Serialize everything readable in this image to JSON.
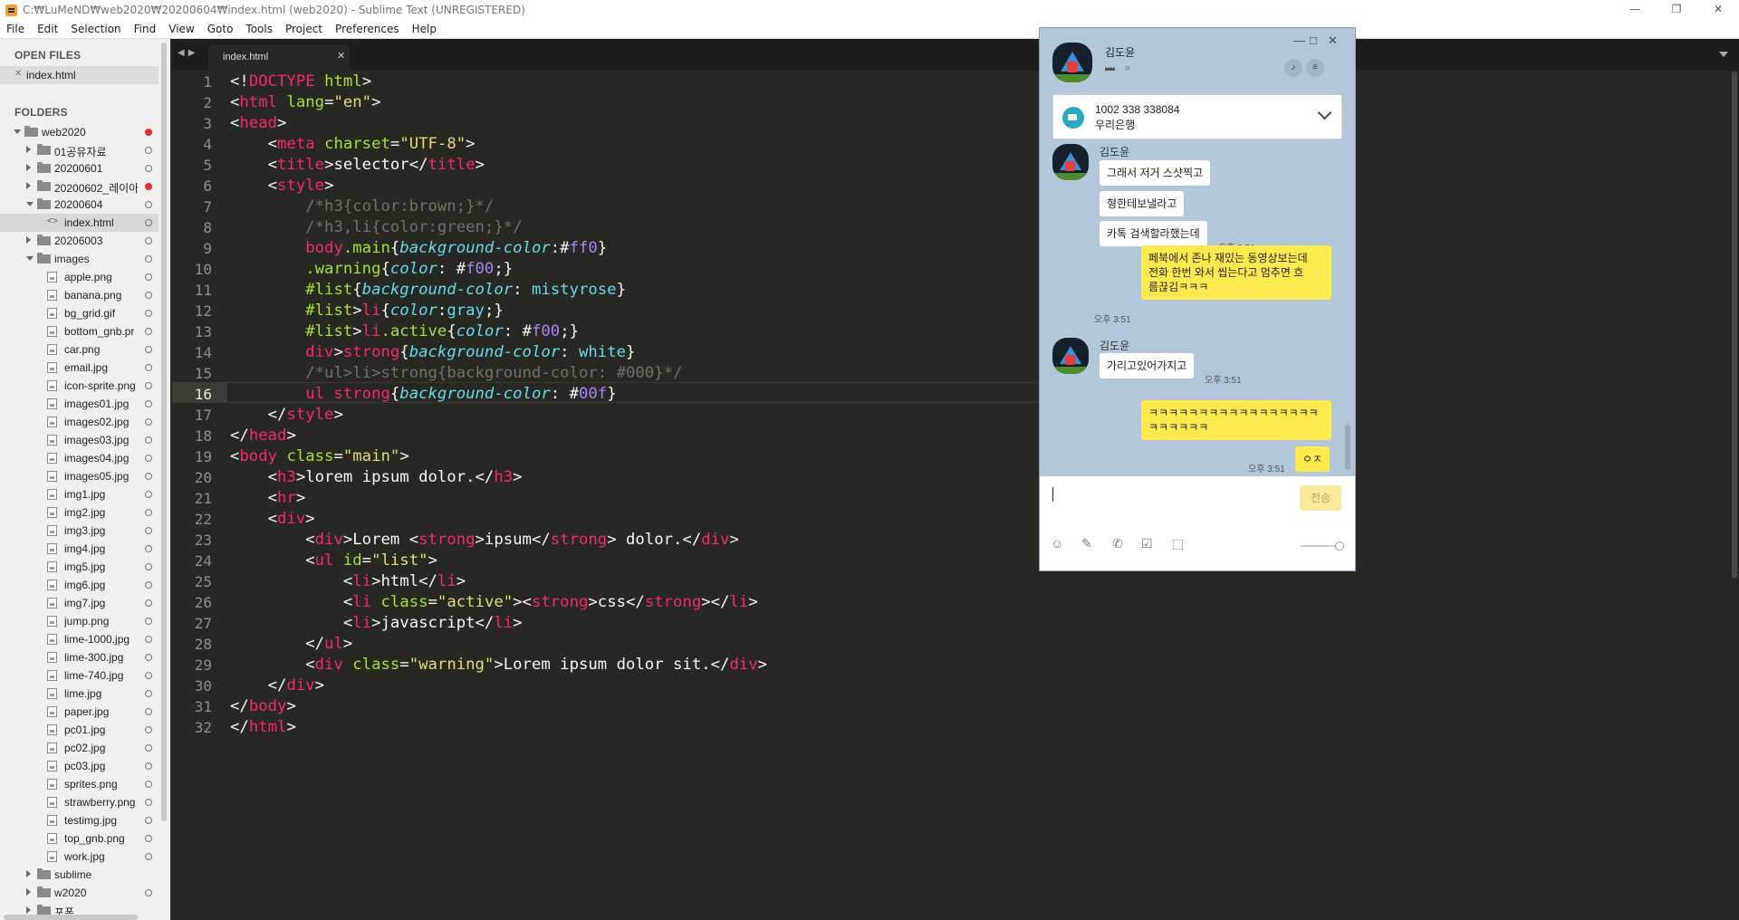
{
  "window": {
    "title": "C:₩LuMeND₩web2020₩20200604₩index.html (web2020) - Sublime Text (UNREGISTERED)",
    "controls": [
      "—",
      "❐",
      "✕"
    ]
  },
  "menu": [
    "File",
    "Edit",
    "Selection",
    "Find",
    "View",
    "Goto",
    "Tools",
    "Project",
    "Preferences",
    "Help"
  ],
  "sidebar": {
    "open_files_header": "OPEN FILES",
    "open_file": "index.html",
    "folders_header": "FOLDERS",
    "tree": [
      {
        "label": "web2020",
        "kind": "folder",
        "depth": 0,
        "arrow": "open",
        "status": "red"
      },
      {
        "label": "01공유자료",
        "kind": "folder",
        "depth": 1,
        "arrow": "closed",
        "status": "circle"
      },
      {
        "label": "20200601",
        "kind": "folder",
        "depth": 1,
        "arrow": "closed",
        "status": "circle"
      },
      {
        "label": "20200602_레이아",
        "kind": "folder",
        "depth": 1,
        "arrow": "closed",
        "status": "red"
      },
      {
        "label": "20200604",
        "kind": "folder",
        "depth": 1,
        "arrow": "open",
        "status": "circle"
      },
      {
        "label": "index.html",
        "kind": "code",
        "depth": 2,
        "arrow": "none",
        "status": "circle",
        "selected": true
      },
      {
        "label": "20206003",
        "kind": "folder",
        "depth": 1,
        "arrow": "closed",
        "status": "circle"
      },
      {
        "label": "images",
        "kind": "folder",
        "depth": 1,
        "arrow": "open",
        "status": "circle"
      },
      {
        "label": "apple.png",
        "kind": "file",
        "depth": 2,
        "arrow": "none",
        "status": "circle"
      },
      {
        "label": "banana.png",
        "kind": "file",
        "depth": 2,
        "arrow": "none",
        "status": "circle"
      },
      {
        "label": "bg_grid.gif",
        "kind": "file",
        "depth": 2,
        "arrow": "none",
        "status": "circle"
      },
      {
        "label": "bottom_gnb.pr",
        "kind": "file",
        "depth": 2,
        "arrow": "none",
        "status": "circle"
      },
      {
        "label": "car.png",
        "kind": "file",
        "depth": 2,
        "arrow": "none",
        "status": "circle"
      },
      {
        "label": "email.jpg",
        "kind": "file",
        "depth": 2,
        "arrow": "none",
        "status": "circle"
      },
      {
        "label": "icon-sprite.png",
        "kind": "file",
        "depth": 2,
        "arrow": "none",
        "status": "circle"
      },
      {
        "label": "images01.jpg",
        "kind": "file",
        "depth": 2,
        "arrow": "none",
        "status": "circle"
      },
      {
        "label": "images02.jpg",
        "kind": "file",
        "depth": 2,
        "arrow": "none",
        "status": "circle"
      },
      {
        "label": "images03.jpg",
        "kind": "file",
        "depth": 2,
        "arrow": "none",
        "status": "circle"
      },
      {
        "label": "images04.jpg",
        "kind": "file",
        "depth": 2,
        "arrow": "none",
        "status": "circle"
      },
      {
        "label": "images05.jpg",
        "kind": "file",
        "depth": 2,
        "arrow": "none",
        "status": "circle"
      },
      {
        "label": "img1.jpg",
        "kind": "file",
        "depth": 2,
        "arrow": "none",
        "status": "circle"
      },
      {
        "label": "img2.jpg",
        "kind": "file",
        "depth": 2,
        "arrow": "none",
        "status": "circle"
      },
      {
        "label": "img3.jpg",
        "kind": "file",
        "depth": 2,
        "arrow": "none",
        "status": "circle"
      },
      {
        "label": "img4.jpg",
        "kind": "file",
        "depth": 2,
        "arrow": "none",
        "status": "circle"
      },
      {
        "label": "img5.jpg",
        "kind": "file",
        "depth": 2,
        "arrow": "none",
        "status": "circle"
      },
      {
        "label": "img6.jpg",
        "kind": "file",
        "depth": 2,
        "arrow": "none",
        "status": "circle"
      },
      {
        "label": "img7.jpg",
        "kind": "file",
        "depth": 2,
        "arrow": "none",
        "status": "circle"
      },
      {
        "label": "jump.png",
        "kind": "file",
        "depth": 2,
        "arrow": "none",
        "status": "circle"
      },
      {
        "label": "lime-1000.jpg",
        "kind": "file",
        "depth": 2,
        "arrow": "none",
        "status": "circle"
      },
      {
        "label": "lime-300.jpg",
        "kind": "file",
        "depth": 2,
        "arrow": "none",
        "status": "circle"
      },
      {
        "label": "lime-740.jpg",
        "kind": "file",
        "depth": 2,
        "arrow": "none",
        "status": "circle"
      },
      {
        "label": "lime.jpg",
        "kind": "file",
        "depth": 2,
        "arrow": "none",
        "status": "circle"
      },
      {
        "label": "paper.jpg",
        "kind": "file",
        "depth": 2,
        "arrow": "none",
        "status": "circle"
      },
      {
        "label": "pc01.jpg",
        "kind": "file",
        "depth": 2,
        "arrow": "none",
        "status": "circle"
      },
      {
        "label": "pc02.jpg",
        "kind": "file",
        "depth": 2,
        "arrow": "none",
        "status": "circle"
      },
      {
        "label": "pc03.jpg",
        "kind": "file",
        "depth": 2,
        "arrow": "none",
        "status": "circle"
      },
      {
        "label": "sprites.png",
        "kind": "file",
        "depth": 2,
        "arrow": "none",
        "status": "circle"
      },
      {
        "label": "strawberry.png",
        "kind": "file",
        "depth": 2,
        "arrow": "none",
        "status": "circle"
      },
      {
        "label": "testimg.jpg",
        "kind": "file",
        "depth": 2,
        "arrow": "none",
        "status": "circle"
      },
      {
        "label": "top_gnb.png",
        "kind": "file",
        "depth": 2,
        "arrow": "none",
        "status": "circle"
      },
      {
        "label": "work.jpg",
        "kind": "file",
        "depth": 2,
        "arrow": "none",
        "status": "circle"
      },
      {
        "label": "sublime",
        "kind": "folder",
        "depth": 1,
        "arrow": "closed",
        "status": "none"
      },
      {
        "label": "w2020",
        "kind": "folder",
        "depth": 1,
        "arrow": "closed",
        "status": "circle"
      },
      {
        "label": "포폰",
        "kind": "folder",
        "depth": 1,
        "arrow": "closed",
        "status": "none"
      }
    ]
  },
  "editor": {
    "tab_label": "index.html",
    "tab_close": "✕",
    "current_line": 16,
    "lines": [
      [
        [
          "w",
          "<!"
        ],
        [
          "t",
          "DOCTYPE"
        ],
        [
          "w",
          " "
        ],
        [
          "a",
          "html"
        ],
        [
          "w",
          ">"
        ]
      ],
      [
        [
          "w",
          "<"
        ],
        [
          "t",
          "html"
        ],
        [
          "w",
          " "
        ],
        [
          "a",
          "lang"
        ],
        [
          "w",
          "="
        ],
        [
          "s",
          "\"en\""
        ],
        [
          "w",
          ">"
        ]
      ],
      [
        [
          "w",
          "<"
        ],
        [
          "t",
          "head"
        ],
        [
          "w",
          ">"
        ]
      ],
      [
        [
          "w",
          "    <"
        ],
        [
          "t",
          "meta"
        ],
        [
          "w",
          " "
        ],
        [
          "a",
          "charset"
        ],
        [
          "w",
          "="
        ],
        [
          "s",
          "\"UTF-8\""
        ],
        [
          "w",
          ">"
        ]
      ],
      [
        [
          "w",
          "    <"
        ],
        [
          "t",
          "title"
        ],
        [
          "w",
          ">selector</"
        ],
        [
          "t",
          "title"
        ],
        [
          "w",
          ">"
        ]
      ],
      [
        [
          "w",
          "    <"
        ],
        [
          "t",
          "style"
        ],
        [
          "w",
          ">"
        ]
      ],
      [
        [
          "c",
          "        /*h3{color:brown;}*/"
        ]
      ],
      [
        [
          "c",
          "        /*h3,li{color:green;}*/"
        ]
      ],
      [
        [
          "w",
          "        "
        ],
        [
          "t",
          "body"
        ],
        [
          "a",
          ".main"
        ],
        [
          "w",
          "{"
        ],
        [
          "p",
          "background-color"
        ],
        [
          "w",
          ":"
        ],
        [
          "w",
          "#"
        ],
        [
          "n",
          "ff0"
        ],
        [
          "w",
          "}"
        ]
      ],
      [
        [
          "w",
          "        "
        ],
        [
          "a",
          ".warning"
        ],
        [
          "w",
          "{"
        ],
        [
          "p",
          "color"
        ],
        [
          "w",
          ": #"
        ],
        [
          "n",
          "f00"
        ],
        [
          "w",
          ";}"
        ]
      ],
      [
        [
          "w",
          "        "
        ],
        [
          "a",
          "#list"
        ],
        [
          "w",
          "{"
        ],
        [
          "p",
          "background-color"
        ],
        [
          "w",
          ": "
        ],
        [
          "v",
          "mistyrose"
        ],
        [
          "w",
          "}"
        ]
      ],
      [
        [
          "w",
          "        "
        ],
        [
          "a",
          "#list"
        ],
        [
          "w",
          ">"
        ],
        [
          "t",
          "li"
        ],
        [
          "w",
          "{"
        ],
        [
          "p",
          "color"
        ],
        [
          "w",
          ":"
        ],
        [
          "v",
          "gray"
        ],
        [
          "w",
          ";}"
        ]
      ],
      [
        [
          "w",
          "        "
        ],
        [
          "a",
          "#list"
        ],
        [
          "w",
          ">"
        ],
        [
          "t",
          "li"
        ],
        [
          "a",
          ".active"
        ],
        [
          "w",
          "{"
        ],
        [
          "p",
          "color"
        ],
        [
          "w",
          ": #"
        ],
        [
          "n",
          "f00"
        ],
        [
          "w",
          ";}"
        ]
      ],
      [
        [
          "w",
          "        "
        ],
        [
          "t",
          "div"
        ],
        [
          "w",
          ">"
        ],
        [
          "t",
          "strong"
        ],
        [
          "w",
          "{"
        ],
        [
          "p",
          "background-color"
        ],
        [
          "w",
          ": "
        ],
        [
          "v",
          "white"
        ],
        [
          "w",
          "}"
        ]
      ],
      [
        [
          "c",
          "        /*ul>li>strong{background-color: #000}*/"
        ]
      ],
      [
        [
          "w",
          "        "
        ],
        [
          "t",
          "ul"
        ],
        [
          "w",
          " "
        ],
        [
          "t",
          "strong"
        ],
        [
          "w",
          "{"
        ],
        [
          "p",
          "background-color"
        ],
        [
          "w",
          ": #"
        ],
        [
          "n",
          "00f"
        ],
        [
          "w",
          "}"
        ]
      ],
      [
        [
          "w",
          "    </"
        ],
        [
          "t",
          "style"
        ],
        [
          "w",
          ">"
        ]
      ],
      [
        [
          "w",
          "</"
        ],
        [
          "t",
          "head"
        ],
        [
          "w",
          ">"
        ]
      ],
      [
        [
          "w",
          "<"
        ],
        [
          "t",
          "body"
        ],
        [
          "w",
          " "
        ],
        [
          "a",
          "class"
        ],
        [
          "w",
          "="
        ],
        [
          "s",
          "\"main\""
        ],
        [
          "w",
          ">"
        ]
      ],
      [
        [
          "w",
          "    <"
        ],
        [
          "t",
          "h3"
        ],
        [
          "w",
          ">lorem ipsum dolor.</"
        ],
        [
          "t",
          "h3"
        ],
        [
          "w",
          ">"
        ]
      ],
      [
        [
          "w",
          "    <"
        ],
        [
          "t",
          "hr"
        ],
        [
          "w",
          ">"
        ]
      ],
      [
        [
          "w",
          "    <"
        ],
        [
          "t",
          "div"
        ],
        [
          "w",
          ">"
        ]
      ],
      [
        [
          "w",
          "        <"
        ],
        [
          "t",
          "div"
        ],
        [
          "w",
          ">Lorem <"
        ],
        [
          "t",
          "strong"
        ],
        [
          "w",
          ">ipsum</"
        ],
        [
          "t",
          "strong"
        ],
        [
          "w",
          "> dolor.</"
        ],
        [
          "t",
          "div"
        ],
        [
          "w",
          ">"
        ]
      ],
      [
        [
          "w",
          "        <"
        ],
        [
          "t",
          "ul"
        ],
        [
          "w",
          " "
        ],
        [
          "a",
          "id"
        ],
        [
          "w",
          "="
        ],
        [
          "s",
          "\"list\""
        ],
        [
          "w",
          ">"
        ]
      ],
      [
        [
          "w",
          "            <"
        ],
        [
          "t",
          "li"
        ],
        [
          "w",
          ">html</"
        ],
        [
          "t",
          "li"
        ],
        [
          "w",
          ">"
        ]
      ],
      [
        [
          "w",
          "            <"
        ],
        [
          "t",
          "li"
        ],
        [
          "w",
          " "
        ],
        [
          "a",
          "class"
        ],
        [
          "w",
          "="
        ],
        [
          "s",
          "\"active\""
        ],
        [
          "w",
          "><"
        ],
        [
          "t",
          "strong"
        ],
        [
          "w",
          ">css</"
        ],
        [
          "t",
          "strong"
        ],
        [
          "w",
          "></"
        ],
        [
          "t",
          "li"
        ],
        [
          "w",
          ">"
        ]
      ],
      [
        [
          "w",
          "            <"
        ],
        [
          "t",
          "li"
        ],
        [
          "w",
          ">javascript</"
        ],
        [
          "t",
          "li"
        ],
        [
          "w",
          ">"
        ]
      ],
      [
        [
          "w",
          "        </"
        ],
        [
          "t",
          "ul"
        ],
        [
          "w",
          ">"
        ]
      ],
      [
        [
          "w",
          "        <"
        ],
        [
          "t",
          "div"
        ],
        [
          "w",
          " "
        ],
        [
          "a",
          "class"
        ],
        [
          "w",
          "="
        ],
        [
          "s",
          "\"warning\""
        ],
        [
          "w",
          ">Lorem ipsum dolor sit.</"
        ],
        [
          "t",
          "div"
        ],
        [
          "w",
          ">"
        ]
      ],
      [
        [
          "w",
          "    </"
        ],
        [
          "t",
          "div"
        ],
        [
          "w",
          ">"
        ]
      ],
      [
        [
          "w",
          "</"
        ],
        [
          "t",
          "body"
        ],
        [
          "w",
          ">"
        ]
      ],
      [
        [
          "w",
          "</"
        ],
        [
          "t",
          "html"
        ],
        [
          "w",
          ">"
        ]
      ]
    ]
  },
  "chat": {
    "contact_name": "김도윤",
    "window_controls": [
      "—",
      "□",
      "✕"
    ],
    "notice_line1": "1002 338 338084",
    "notice_line2": "우리은행",
    "sender_name": "김도윤",
    "messages": {
      "m1": "그래서 저거 스샷찍고",
      "m2": "형한테보낼라고",
      "m3": "카톡 검색할라했는데",
      "t1": "오후 3:51",
      "m4_l1": "페북에서 존나 재밌는 동영상보는데",
      "m4_l2": "전화 한번 와서 씹는다고 멈추면 흐",
      "m4_l3": "름끊김ㅋㅋㅋ",
      "t2": "오후 3:51",
      "m5": "가리고있어가지고",
      "t3": "오후 3:51",
      "m6_l1": "ㅋㅋㅋㅋㅋㅋㅋㅋㅋㅋㅋㅋㅋㅋㅋㅋㅋ",
      "m6_l2": "ㅋㅋㅋㅋㅋㅋ",
      "m7": "ㅇㅈ",
      "t4": "오후 3:51"
    },
    "send_label": "전송",
    "colors": {
      "bg": "#b2c7da",
      "my_bubble": "#fee94e",
      "their_bubble": "#ffffff"
    }
  },
  "syntax_colors": {
    "tag": "#f92672",
    "attr": "#a6e22e",
    "string": "#e6db74",
    "comment": "#75715e",
    "property": "#66d9ef",
    "number": "#ae81ff"
  }
}
